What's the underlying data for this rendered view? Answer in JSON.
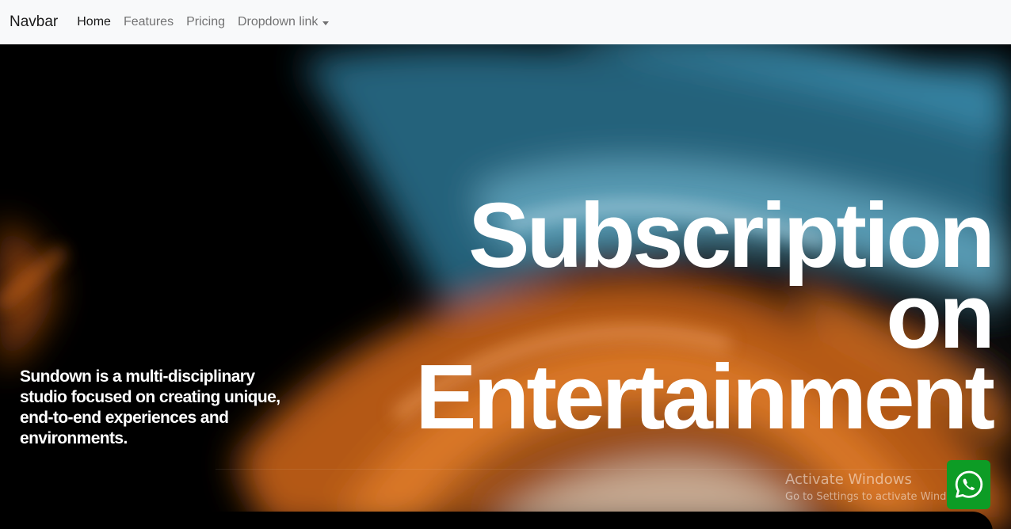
{
  "navbar": {
    "brand": "Navbar",
    "links": [
      {
        "label": "Home",
        "active": true
      },
      {
        "label": "Features",
        "active": false
      },
      {
        "label": "Pricing",
        "active": false
      },
      {
        "label": "Dropdown link",
        "active": false,
        "dropdown": true
      }
    ]
  },
  "hero": {
    "title_lines": [
      "Subscription",
      "on",
      "Entertainment"
    ],
    "description": "Sundown is a multi-disciplinary studio focused on creating unique, end-to-end experiences and environments.",
    "background_colors": {
      "base": "#000000",
      "blue": "#2f7f99",
      "orange": "#c8621a"
    }
  },
  "watermark": {
    "title": "Activate Windows",
    "subtitle": "Go to Settings to activate Windows."
  },
  "whatsapp": {
    "icon": "whatsapp-icon",
    "color": "#0d9c25"
  }
}
